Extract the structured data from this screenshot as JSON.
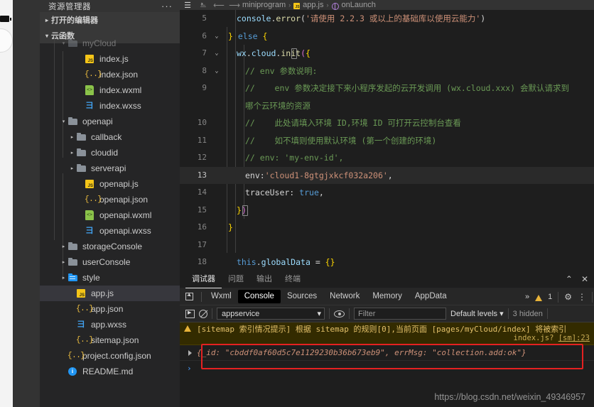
{
  "simulator": {
    "battery_icon": "battery-icon",
    "home_circle": "home-button"
  },
  "sidebar": {
    "title": "资源管理器",
    "more_label": "···",
    "sections": [
      {
        "label": "打开的编辑器",
        "expanded": false,
        "arrow": "▸"
      },
      {
        "label": "云函数",
        "expanded": true,
        "arrow": "▾"
      }
    ],
    "tree": [
      {
        "label": "myCloud",
        "icon": "folder",
        "indent": 2,
        "arrow": "▾",
        "active": false,
        "clipped": true
      },
      {
        "label": "index.js",
        "icon": "js",
        "indent": 4,
        "arrow": "",
        "active": false
      },
      {
        "label": "index.json",
        "icon": "json",
        "indent": 4,
        "arrow": "",
        "active": false
      },
      {
        "label": "index.wxml",
        "icon": "wxml",
        "indent": 4,
        "arrow": "",
        "active": false
      },
      {
        "label": "index.wxss",
        "icon": "wxss",
        "indent": 4,
        "arrow": "",
        "active": false
      },
      {
        "label": "openapi",
        "icon": "folder",
        "indent": 2,
        "arrow": "▾",
        "active": false
      },
      {
        "label": "callback",
        "icon": "folder",
        "indent": 3,
        "arrow": "▸",
        "active": false
      },
      {
        "label": "cloudid",
        "icon": "folder",
        "indent": 3,
        "arrow": "▸",
        "active": false
      },
      {
        "label": "serverapi",
        "icon": "folder",
        "indent": 3,
        "arrow": "▸",
        "active": false
      },
      {
        "label": "openapi.js",
        "icon": "js",
        "indent": 4,
        "arrow": "",
        "active": false
      },
      {
        "label": "openapi.json",
        "icon": "json",
        "indent": 4,
        "arrow": "",
        "active": false
      },
      {
        "label": "openapi.wxml",
        "icon": "wxml",
        "indent": 4,
        "arrow": "",
        "active": false
      },
      {
        "label": "openapi.wxss",
        "icon": "wxss",
        "indent": 4,
        "arrow": "",
        "active": false
      },
      {
        "label": "storageConsole",
        "icon": "folder",
        "indent": 2,
        "arrow": "▸",
        "active": false
      },
      {
        "label": "userConsole",
        "icon": "folder",
        "indent": 2,
        "arrow": "▸",
        "active": false
      },
      {
        "label": "style",
        "icon": "folder-blue",
        "indent": 2,
        "arrow": "▸",
        "active": false
      },
      {
        "label": "app.js",
        "icon": "js",
        "indent": 3,
        "arrow": "",
        "active": true
      },
      {
        "label": "app.json",
        "icon": "json",
        "indent": 3,
        "arrow": "",
        "active": false
      },
      {
        "label": "app.wxss",
        "icon": "wxss",
        "indent": 3,
        "arrow": "",
        "active": false
      },
      {
        "label": "sitemap.json",
        "icon": "json",
        "indent": 3,
        "arrow": "",
        "active": false
      },
      {
        "label": "project.config.json",
        "icon": "json",
        "indent": 2,
        "arrow": "",
        "active": false
      },
      {
        "label": "README.md",
        "icon": "md",
        "indent": 2,
        "arrow": "",
        "active": false
      }
    ]
  },
  "editor": {
    "toolbar_icons": [
      "menu-icon",
      "bookmark-icon",
      "back-arrow-icon",
      "forward-arrow-icon"
    ],
    "breadcrumb": {
      "root": "miniprogram",
      "file": "app.js",
      "symbol": "onLaunch",
      "sep": "›"
    },
    "lines": [
      {
        "num": "5",
        "fold": "",
        "hl": false,
        "tokens": [
          {
            "t": "console",
            "c": "prop"
          },
          {
            "t": ".",
            "c": "plain"
          },
          {
            "t": "error",
            "c": "fn"
          },
          {
            "t": "(",
            "c": "punc"
          },
          {
            "t": "'请使用 2.2.3 或以上的基础库以使用云能力'",
            "c": "str"
          },
          {
            "t": ")",
            "c": "punc"
          }
        ],
        "indent": 1
      },
      {
        "num": "6",
        "fold": "⌄",
        "hl": false,
        "tokens": [
          {
            "t": "} ",
            "c": "y"
          },
          {
            "t": "else",
            "c": "key"
          },
          {
            "t": " {",
            "c": "y"
          }
        ],
        "indent": 0
      },
      {
        "num": "7",
        "fold": "⌄",
        "hl": false,
        "tokens": [
          {
            "t": "wx",
            "c": "prop"
          },
          {
            "t": ".",
            "c": "plain"
          },
          {
            "t": "cloud",
            "c": "prop"
          },
          {
            "t": ".",
            "c": "plain"
          },
          {
            "t": "init",
            "c": "fn"
          },
          {
            "t": "(",
            "c": "pink"
          },
          {
            "t": "{",
            "c": "y"
          }
        ],
        "indent": 1
      },
      {
        "num": "8",
        "fold": "⌄",
        "hl": false,
        "tokens": [
          {
            "t": "// env 参数说明:",
            "c": "cmt"
          }
        ],
        "indent": 2
      },
      {
        "num": "9",
        "fold": "",
        "hl": false,
        "tokens": [
          {
            "t": "//    env 参数决定接下来小程序发起的云开发调用 (wx.cloud.xxx) 会默认请求到",
            "c": "cmt"
          }
        ],
        "indent": 2
      },
      {
        "num": "",
        "fold": "",
        "hl": false,
        "tokens": [
          {
            "t": "哪个云环境的资源",
            "c": "cmt"
          }
        ],
        "indent": 2
      },
      {
        "num": "10",
        "fold": "",
        "hl": false,
        "tokens": [
          {
            "t": "//    此处请填入环境 ID,环境 ID 可打开云控制台查看",
            "c": "cmt"
          }
        ],
        "indent": 2
      },
      {
        "num": "11",
        "fold": "",
        "hl": false,
        "tokens": [
          {
            "t": "//    如不填则使用默认环境 (第一个创建的环境)",
            "c": "cmt"
          }
        ],
        "indent": 2
      },
      {
        "num": "12",
        "fold": "",
        "hl": false,
        "tokens": [
          {
            "t": "// env: 'my-env-id',",
            "c": "cmt"
          }
        ],
        "indent": 2
      },
      {
        "num": "13",
        "fold": "",
        "hl": true,
        "tokens": [
          {
            "t": "env:",
            "c": "plain"
          },
          {
            "t": "'cloud1-8gtgjxkcf032a206'",
            "c": "str"
          },
          {
            "t": ",",
            "c": "plain"
          }
        ],
        "indent": 2
      },
      {
        "num": "14",
        "fold": "",
        "hl": false,
        "tokens": [
          {
            "t": "traceUser: ",
            "c": "plain"
          },
          {
            "t": "true",
            "c": "bool"
          },
          {
            "t": ",",
            "c": "plain"
          }
        ],
        "indent": 2
      },
      {
        "num": "15",
        "fold": "",
        "hl": false,
        "tokens": [
          {
            "t": "}",
            "c": "y"
          },
          {
            "t": ")",
            "c": "pink"
          }
        ],
        "indent": 1
      },
      {
        "num": "16",
        "fold": "",
        "hl": false,
        "tokens": [
          {
            "t": "}",
            "c": "y"
          }
        ],
        "indent": 0
      },
      {
        "num": "17",
        "fold": "",
        "hl": false,
        "tokens": [],
        "indent": 0
      },
      {
        "num": "18",
        "fold": "",
        "hl": false,
        "tokens": [
          {
            "t": "this",
            "c": "key"
          },
          {
            "t": ".",
            "c": "plain"
          },
          {
            "t": "globalData",
            "c": "prop"
          },
          {
            "t": " = ",
            "c": "plain"
          },
          {
            "t": "{}",
            "c": "y"
          }
        ],
        "indent": 1
      }
    ]
  },
  "panel": {
    "tabs": [
      {
        "label": "调试器",
        "selected": true
      },
      {
        "label": "问题",
        "selected": false
      },
      {
        "label": "输出",
        "selected": false
      },
      {
        "label": "终端",
        "selected": false
      }
    ],
    "collapse_icon": "chevron-up-icon",
    "close_icon": "close-icon",
    "devtools_tabs": [
      {
        "label": "Wxml",
        "selected": false
      },
      {
        "label": "Console",
        "selected": true
      },
      {
        "label": "Sources",
        "selected": false
      },
      {
        "label": "Network",
        "selected": false
      },
      {
        "label": "Memory",
        "selected": false
      },
      {
        "label": "AppData",
        "selected": false
      }
    ],
    "overflow_label": "»",
    "warning_count": "1",
    "settings_icon": "gear-icon",
    "kebab_icon": "more-vertical-icon",
    "toolbar": {
      "execute_icon": "execute-icon",
      "clear_icon": "clear-console-icon",
      "context_value": "appservice",
      "context_caret": "▾",
      "eye_icon": "eye-icon",
      "filter_placeholder": "Filter",
      "filter_value": "",
      "levels_label": "Default levels",
      "levels_caret": "▾",
      "hidden_label": "3 hidden"
    },
    "logs": [
      {
        "type": "warning",
        "text": "[sitemap 索引情况提示] 根据 sitemap 的规则[0],当前页面 [pages/myCloud/index] 将被索引",
        "source_file": "index.js?",
        "source_loc": "[sm]:23"
      },
      {
        "type": "object",
        "expander": "▶",
        "text": "{_id: \"cbddf0af60d5c7e1129230b36b673eb9\", errMsg: \"collection.add:ok\"}"
      }
    ],
    "prompt_chevron": "›"
  },
  "watermark": "https://blog.csdn.net/weixin_49346957",
  "colors": {
    "accent_red_box": "#e42121",
    "warning_yellow": "#e8b339",
    "string_orange": "#ce9178",
    "comment_green": "#6a9955",
    "keyword_blue": "#569cd6"
  }
}
